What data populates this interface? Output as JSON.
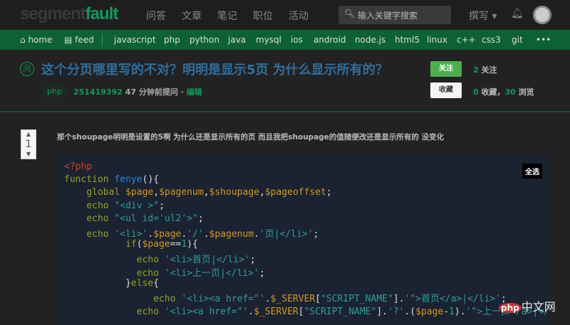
{
  "header": {
    "logo_a": "segment",
    "logo_b": "fault",
    "menu": [
      "问答",
      "文章",
      "笔记",
      "职位",
      "活动"
    ],
    "search_placeholder": "输入关键字搜索",
    "write": "撰写 ▾"
  },
  "tags_nav": {
    "home": "home",
    "feed": "feed",
    "items": [
      "javascript",
      "php",
      "python",
      "java",
      "mysql",
      "ios",
      "android",
      "node.js",
      "html5",
      "linux",
      "c++",
      "css3",
      "git"
    ],
    "more": "•••"
  },
  "question": {
    "badge": "问",
    "title": "这个分页哪里写的不对？明明是显示5页 为什么显示所有的？",
    "tag": "php",
    "author": "251419392",
    "time": "47 分钟前提问 · ",
    "edit": "编辑",
    "follow_label": "关注",
    "follow_count": "2",
    "follow_text": " 关注",
    "fav_label": "收藏",
    "fav_count": "0",
    "fav_text": " 收藏，",
    "views": "30",
    "views_text": " 浏览",
    "votes": "1",
    "body": "那个shoupage明明是设置的5啊 为什么还是显示所有的页 而且我把shoupage的值随便改还是显示所有的 没变化"
  },
  "code": {
    "select_all": "全选",
    "lines": [
      [
        [
          "tagc",
          "<?php"
        ]
      ],
      [
        [
          "kw",
          "function "
        ],
        [
          "fn",
          "fenye"
        ],
        [
          "",
          "(){"
        ]
      ],
      [
        [
          "",
          "    "
        ],
        [
          "kw",
          "global "
        ],
        [
          "var",
          "$page"
        ],
        [
          "",
          ","
        ],
        [
          "var",
          "$pagenum"
        ],
        [
          "",
          ","
        ],
        [
          "var",
          "$shoupage"
        ],
        [
          "",
          ","
        ],
        [
          "var",
          "$pageoffset"
        ],
        [
          "",
          ";"
        ]
      ],
      [
        [
          "",
          "    "
        ],
        [
          "kw",
          "echo "
        ],
        [
          "str",
          "\"<div >\""
        ],
        [
          "",
          ";"
        ]
      ],
      [
        [
          "",
          "    "
        ],
        [
          "kw",
          "echo "
        ],
        [
          "str",
          "\"<ul id='ul2'>\""
        ],
        [
          "",
          ";"
        ]
      ],
      [
        [
          "",
          "    "
        ],
        [
          "kw",
          "echo "
        ],
        [
          "str",
          "'<li>'"
        ],
        [
          "",
          "."
        ],
        [
          "var",
          "$page"
        ],
        [
          "",
          "."
        ],
        [
          "str",
          "'/'"
        ],
        [
          "",
          "."
        ],
        [
          "var",
          "$pagenum"
        ],
        [
          "",
          "."
        ],
        [
          "str",
          "'页|</li>'"
        ],
        [
          "",
          ";"
        ]
      ],
      [
        [
          "",
          "           "
        ],
        [
          "kw",
          "if"
        ],
        [
          "",
          "("
        ],
        [
          "var",
          "$page"
        ],
        [
          "",
          "=="
        ],
        [
          "num",
          "1"
        ],
        [
          "",
          "){"
        ]
      ],
      [
        [
          "",
          "             "
        ],
        [
          "kw",
          "echo "
        ],
        [
          "str",
          "'<li>首页|</li>'"
        ],
        [
          "",
          ";"
        ]
      ],
      [
        [
          "",
          "             "
        ],
        [
          "kw",
          "echo "
        ],
        [
          "str",
          "'<li>上一页|</li>'"
        ],
        [
          "",
          ";"
        ]
      ],
      [
        [
          "",
          "           }"
        ],
        [
          "kw",
          "else"
        ],
        [
          "",
          "{"
        ]
      ],
      [
        [
          "",
          "                "
        ],
        [
          "kw",
          "echo "
        ],
        [
          "str",
          "'<li><a href=\"'"
        ],
        [
          "",
          "."
        ],
        [
          "var",
          "$_SERVER"
        ],
        [
          "",
          "["
        ],
        [
          "str",
          "\"SCRIPT_NAME\""
        ],
        [
          "",
          "]."
        ],
        [
          "str",
          "'\">首页</a>|</li>'"
        ],
        [
          "",
          ";"
        ]
      ],
      [
        [
          "",
          "             "
        ],
        [
          "kw",
          "echo "
        ],
        [
          "str",
          "'<li><a href=\"'"
        ],
        [
          "",
          "."
        ],
        [
          "var",
          "$_SERVER"
        ],
        [
          "",
          "["
        ],
        [
          "str",
          "\"SCRIPT_NAME\""
        ],
        [
          "",
          "]."
        ],
        [
          "str",
          "'?'"
        ],
        [
          "",
          ".("
        ],
        [
          "var",
          "$page"
        ],
        [
          "",
          "-"
        ],
        [
          "num",
          "1"
        ],
        [
          "",
          ")."
        ],
        [
          "str",
          "'\">上一页</a>|</"
        ]
      ]
    ]
  },
  "watermark": {
    "a": "php",
    "b": "中文网"
  }
}
